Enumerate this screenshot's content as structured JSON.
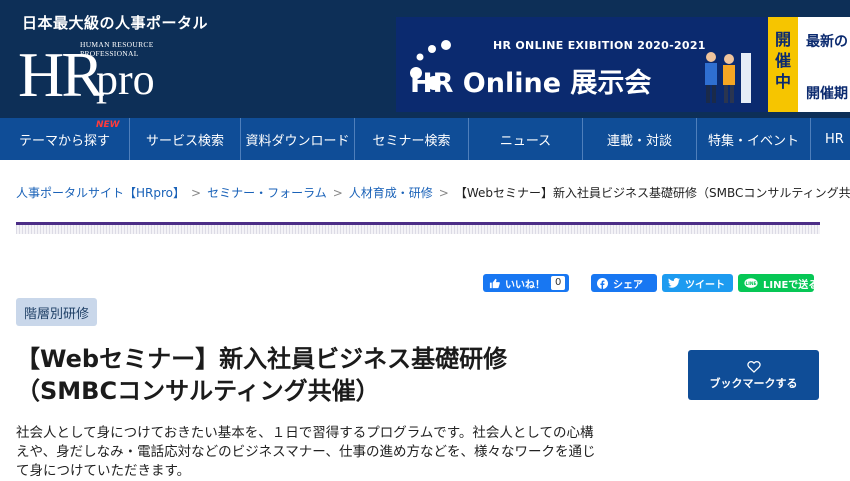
{
  "header": {
    "tagline": "日本最大級の人事ポータル",
    "logo_text": "HRpro",
    "logo_sub": [
      "HUMAN RESOURCE",
      "PROFESSIONAL"
    ]
  },
  "banner": {
    "title": "HR ONLINE EXIBITION 2020-2021",
    "main": "HR Online 展示会",
    "badge_chars": [
      "開",
      "催",
      "中"
    ],
    "side_lines": [
      "最新の",
      "開催期"
    ]
  },
  "nav": {
    "new_badge": "NEW",
    "items": [
      {
        "label": "テーマから探す"
      },
      {
        "label": "サービス検索"
      },
      {
        "label": "資料ダウンロード"
      },
      {
        "label": "セミナー検索"
      },
      {
        "label": "ニュース"
      },
      {
        "label": "連載・対談"
      },
      {
        "label": "特集・イベント"
      },
      {
        "label": "HR"
      }
    ]
  },
  "breadcrumb": {
    "items": [
      {
        "label": "人事ポータルサイト【HRpro】"
      },
      {
        "label": "セミナー・フォーラム"
      },
      {
        "label": "人材育成・研修"
      }
    ],
    "separator": ">",
    "current": "【Webセミナー】新入社員ビジネス基礎研修（SMBCコンサルティング共催）"
  },
  "share": {
    "like_label": "いいね！",
    "like_count": "0",
    "share_label": "シェア",
    "tweet_label": "ツイート",
    "line_label": "LINEで送る"
  },
  "tag": "階層別研修",
  "title_lines": [
    "【Webセミナー】新入社員ビジネス基礎研修",
    "（SMBCコンサルティング共催）"
  ],
  "bookmark_label": "ブックマークする",
  "description_lines": [
    "社会人として身につけておきたい基本を、１日で習得するプログラムです。社会人としての心構",
    "えや、身だしなみ・電話応対などのビジネスマナー、仕事の進め方などを、様々なワークを通じ",
    "て身につけていただきます。"
  ],
  "colors": {
    "header_bg": "#0d2f57",
    "nav_bg": "#0f4d97",
    "banner_bg": "#0b2a6f",
    "accent_yellow": "#f6c500",
    "link": "#1a62b8",
    "divider_purple": "#4b2d86"
  }
}
